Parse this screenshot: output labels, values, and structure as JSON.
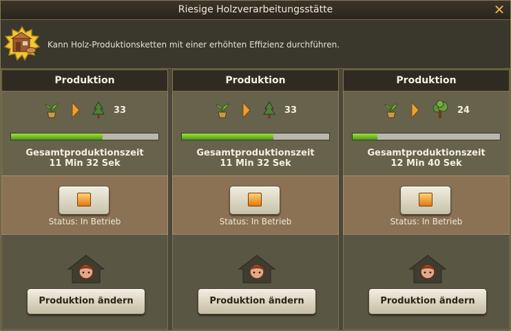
{
  "window": {
    "title": "Riesige Holzverarbeitungsstätte",
    "close_glyph": "✕"
  },
  "description": {
    "text": "Kann Holz-Produktionsketten mit einer erhöhten Effizienz durchführen.",
    "badge_icon": "sawmill-badge-icon"
  },
  "columns": [
    {
      "header": "Produktion",
      "input_icon": "sapling-icon",
      "output_icon": "pine-tree-icon",
      "amount": "33",
      "progress": 0.62,
      "time_label": "Gesamtproduktionszeit",
      "time": "11 Min 32 Sek",
      "status": "Status: In Betrieb",
      "change_label": "Produktion ändern"
    },
    {
      "header": "Produktion",
      "input_icon": "sapling-icon",
      "output_icon": "pine-tree-icon",
      "amount": "33",
      "progress": 0.62,
      "time_label": "Gesamtproduktionszeit",
      "time": "11 Min 32 Sek",
      "status": "Status: In Betrieb",
      "change_label": "Produktion ändern"
    },
    {
      "header": "Produktion",
      "input_icon": "sapling-icon",
      "output_icon": "deciduous-tree-icon",
      "amount": "24",
      "progress": 0.17,
      "time_label": "Gesamtproduktionszeit",
      "time": "12 Min 40 Sek",
      "status": "Status: In Betrieb",
      "change_label": "Produktion ändern"
    }
  ],
  "colors": {
    "progress_fill": "#7cc42a",
    "stop_square": "#f0a030",
    "title_text": "#f2ead8"
  }
}
